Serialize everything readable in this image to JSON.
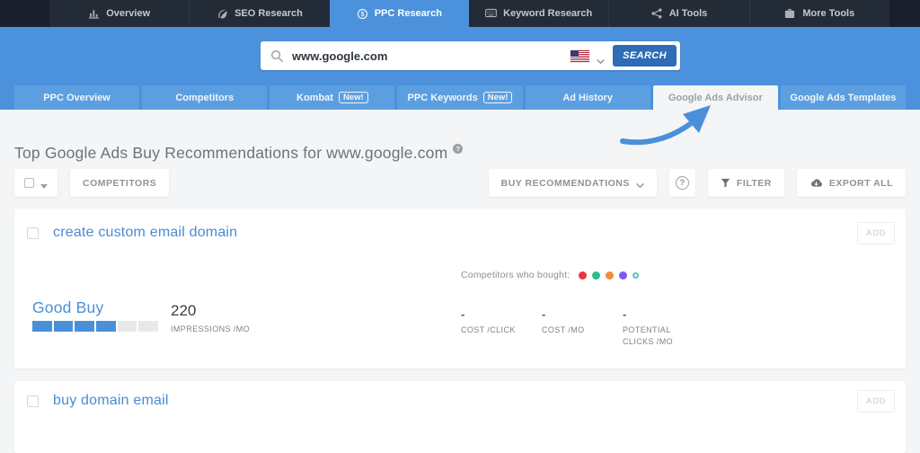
{
  "topnav": {
    "items": [
      {
        "label": "Overview"
      },
      {
        "label": "SEO Research"
      },
      {
        "label": "PPC Research"
      },
      {
        "label": "Keyword Research"
      },
      {
        "label": "AI Tools"
      },
      {
        "label": "More Tools"
      }
    ]
  },
  "search": {
    "value": "www.google.com",
    "button_label": "SEARCH"
  },
  "subnav": {
    "items": [
      {
        "label": "PPC Overview"
      },
      {
        "label": "Competitors"
      },
      {
        "label": "Kombat",
        "badge": "New!"
      },
      {
        "label": "PPC Keywords",
        "badge": "New!"
      },
      {
        "label": "Ad History"
      },
      {
        "label": "Google Ads Advisor"
      },
      {
        "label": "Google Ads Templates"
      }
    ]
  },
  "page": {
    "title": "Top Google Ads Buy Recommendations for www.google.com",
    "help_badge": "?"
  },
  "toolbar": {
    "competitors_label": "COMPETITORS",
    "buy_recommendations_label": "BUY RECOMMENDATIONS",
    "help_label": "?",
    "filter_label": "FILTER",
    "export_all_label": "EXPORT ALL"
  },
  "colors": {
    "accent_blue": "#4a90d9",
    "dots": [
      "#e5383f",
      "#2dbd8a",
      "#f08c3c",
      "#7c5cf0"
    ],
    "open_dot": "#5bc4b8"
  },
  "cards": {
    "first": {
      "title": "create custom email domain",
      "add_label": "ADD",
      "competitors_bought_label": "Competitors who bought:",
      "rating_label": "Good Buy",
      "rating_segments_filled": 4,
      "rating_segments_total": 6,
      "impressions_value": "220",
      "impressions_label": "IMPRESSIONS /MO",
      "stats": [
        {
          "value": "-",
          "label": "COST /CLICK"
        },
        {
          "value": "-",
          "label": "COST /MO"
        },
        {
          "value": "-",
          "label": "POTENTIAL CLICKS /MO"
        }
      ]
    },
    "second": {
      "title": "buy domain email",
      "add_label": "ADD"
    }
  }
}
